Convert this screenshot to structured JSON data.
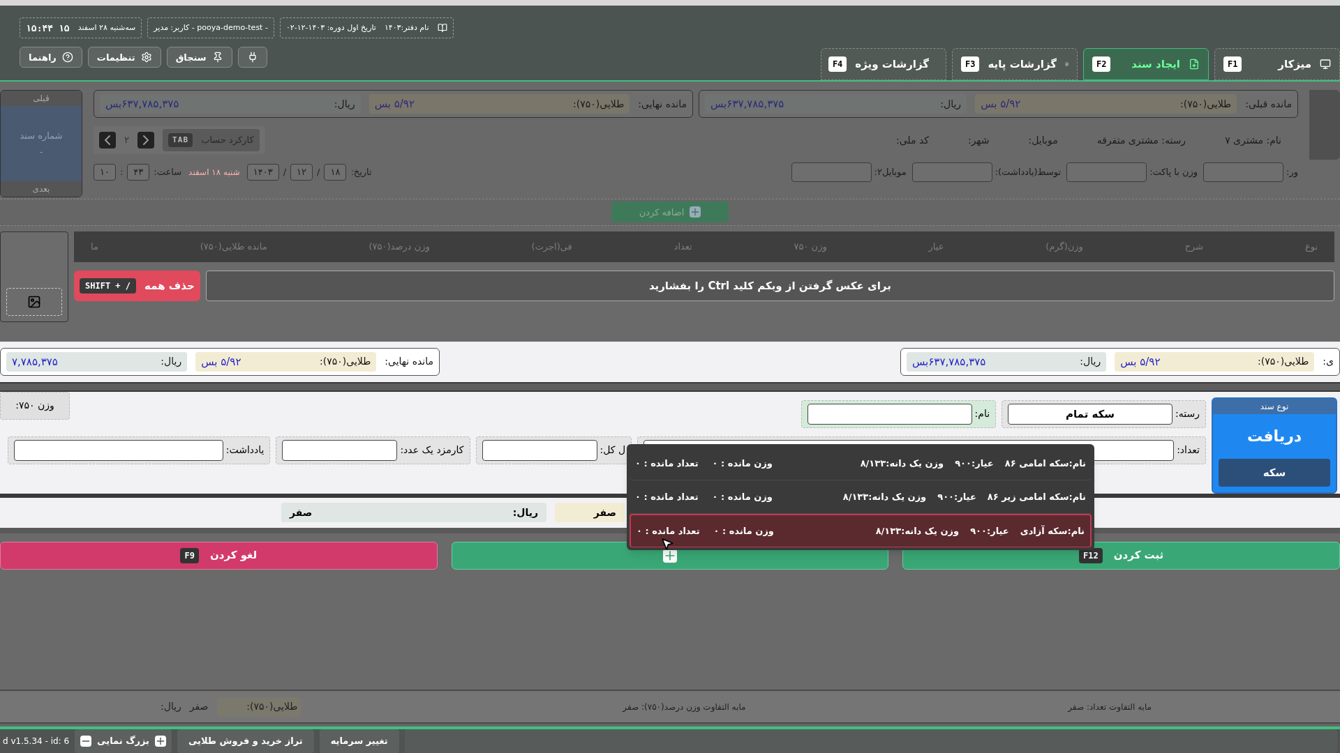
{
  "header": {
    "office": "نام دفتر:۱۴۰۳",
    "period": "تاریخ اول دوره: ۱۴۰۳-۱۲-۰۲",
    "user": "- pooya-demo-test - کاربر: مدیر",
    "date": "سه‌شنبه ۲۸ اسفند",
    "clock": "۱۵:۴۴ ۱۵",
    "tools": [
      {
        "kind": "plug"
      },
      {
        "kind": "pin",
        "label": "سنجاق"
      },
      {
        "kind": "gear",
        "label": "تنظیمات"
      },
      {
        "kind": "help",
        "label": "راهنما"
      }
    ]
  },
  "tabs": [
    {
      "label": "میزکار",
      "key": "F1",
      "selected": false
    },
    {
      "label": "ایجاد سند",
      "key": "F2",
      "selected": true
    },
    {
      "label": "گزارشات پایه",
      "key": "F3",
      "selected": false
    },
    {
      "label": "گزارشات ویژه",
      "key": "F4",
      "selected": false
    }
  ],
  "balances": [
    {
      "label": "مانده قبلی:",
      "gold_label": "طلایی(۷۵۰):",
      "gold": "۵/۹۲ بس",
      "rial_label": "ریال:",
      "rial": "۶۳۷,۷۸۵,۳۷۵بس"
    },
    {
      "label": "مانده نهایی:",
      "gold_label": "طلایی(۷۵۰):",
      "gold": "۵/۹۲ بس",
      "rial_label": "ریال:",
      "rial": "۶۳۷,۷۸۵,۳۷۵بس"
    }
  ],
  "nav": {
    "prev": "قبلی",
    "doc_label": "شماره سند",
    "doc_number": "-",
    "next": "بعدی"
  },
  "account": {
    "page": "۲",
    "tab_key": "TAB",
    "label": "کارکرد حساب"
  },
  "customer": [
    "نام: مشتری ۷",
    "رسته: مشتری متفرقه",
    "موبایل:",
    "شهر:",
    "کد ملی:"
  ],
  "date_row": {
    "label": "تاریخ:",
    "parts": [
      {
        "kind": "box",
        "text": "۱۸"
      },
      {
        "kind": "sep",
        "text": "/"
      },
      {
        "kind": "box",
        "text": "۱۲"
      },
      {
        "kind": "sep",
        "text": "/"
      },
      {
        "kind": "box",
        "text": "۱۴۰۳"
      }
    ],
    "weekday": "شنبه ۱۸ اسفند",
    "time_label": "ساعت:",
    "time_parts": [
      {
        "kind": "box",
        "text": "۴۳"
      },
      {
        "kind": "sep",
        "text": ":"
      },
      {
        "kind": "box",
        "text": "۱۰"
      }
    ]
  },
  "extra_fields": [
    "ور:",
    "وزن با پاکت:",
    "توسط(یادداشت):",
    "موبایل۲:"
  ],
  "add_button": "اضافه کردن",
  "table": {
    "columns": [
      "نوع",
      "شرح",
      "وزن(گرم)",
      "عیار",
      "وزن ۷۵۰",
      "تعداد",
      "فی(اجرت)",
      "وزن درصد(۷۵۰)",
      "مانده طلایی(۷۵۰)",
      "ما"
    ]
  },
  "photo": {
    "delete_all": "حذف همه",
    "shortcut": "SHIFT + /",
    "message": "برای عکس گرفتن از وبکم کلید Ctrl را بفشارید"
  },
  "summary": [
    {
      "label": "ی:",
      "gold_label": "طلایی(۷۵۰):",
      "gold": "۵/۹۲ بس",
      "rial_label": "ریال:",
      "rial": "۶۳۷,۷۸۵,۳۷۵بس"
    },
    {
      "label": "مانده نهایی:",
      "gold_label": "طلایی(۷۵۰):",
      "gold": "۵/۹۲ بس",
      "rial_label": "ریال:",
      "rial": "۷,۷۸۵,۳۷۵"
    }
  ],
  "doc_type": {
    "title": "نوع سند",
    "value": "دریافت",
    "sub": "سکه"
  },
  "form": {
    "row1": [
      {
        "label": "رسته:",
        "value": "سکه تمام"
      },
      {
        "label": "نام:"
      }
    ],
    "row2": [
      {
        "label": "تعداد:"
      },
      {
        "label": "ل کل:"
      },
      {
        "label": "کارمزد یک عدد:"
      },
      {
        "label": "یادداشت:"
      }
    ],
    "weight": "وزن ۷۵۰:"
  },
  "result": {
    "gold": "صفر",
    "rial_label": "ریال:",
    "rial": "صفر"
  },
  "actions": [
    {
      "kind": "submit",
      "label": "ثبت کردن",
      "key": "F12"
    },
    {
      "kind": "add"
    },
    {
      "kind": "cancel",
      "label": "لغو کردن",
      "key": "F9"
    }
  ],
  "footer": {
    "count_diff": "مابه التفاوت تعداد: صفر",
    "weight_diff": "مابه التفاوت وزن درصد(۷۵۰): صفر",
    "gold_label": "طلایی(۷۵۰):",
    "gold": "صفر",
    "rial_label": "ریال:"
  },
  "bottom": {
    "buttons": [
      "تغییر سرمایه",
      "تراز خرید و فروش طلایی"
    ],
    "zoom_label": "بزرگ نمایی",
    "version": "d v1.5.34 - id: 6"
  },
  "dropdown": [
    {
      "name": "نام:سکه امامی ۸۶",
      "karat": "عیار:۹۰۰",
      "unit_weight": "وزن یک دانه:۸/۱۳۳",
      "weight_left": "وزن مانده : ۰",
      "count_left": "تعداد مانده : ۰",
      "selected": false
    },
    {
      "name": "نام:سکه امامی زیر ۸۶",
      "karat": "عیار:۹۰۰",
      "unit_weight": "وزن یک دانه:۸/۱۳۳",
      "weight_left": "وزن مانده : ۰",
      "count_left": "تعداد مانده : ۰",
      "selected": false
    },
    {
      "name": "نام:سکه آزادی",
      "karat": "عیار:۹۰۰",
      "unit_weight": "وزن یک دانه:۸/۱۳۳",
      "weight_left": "وزن مانده : ۰",
      "count_left": "تعداد مانده : ۰",
      "selected": true
    }
  ]
}
